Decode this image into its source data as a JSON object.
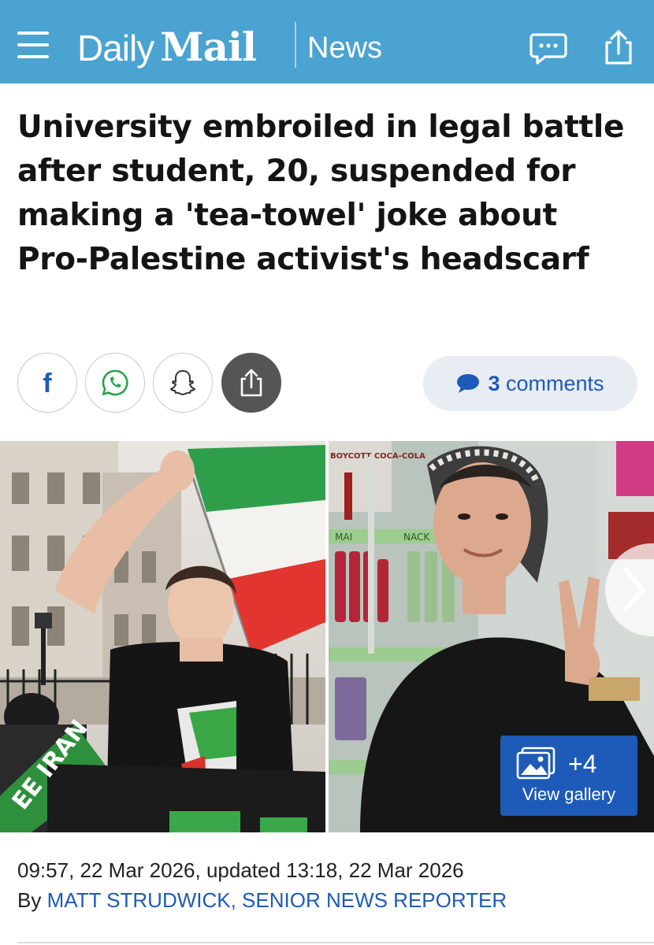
{
  "header": {
    "logo_daily": "Daily",
    "logo_mail": "Mail",
    "section": "News",
    "menu_icon": "hamburger-menu-icon",
    "chat_icon": "chat-bubble-icon",
    "share_icon": "share-upload-icon",
    "background_color": "#4aa3d1"
  },
  "article": {
    "headline": "University embroiled in legal battle after student, 20, suspended for making a 'tea-towel' joke about Pro-Palestine activist's headscarf",
    "timestamp": "09:57, 22 Mar 2026, updated 13:18, 22 Mar 2026",
    "byline_prefix": "By",
    "author": "MATT STRUDWICK, SENIOR NEWS REPORTER"
  },
  "share": {
    "buttons": [
      {
        "name": "facebook",
        "icon": "facebook-icon"
      },
      {
        "name": "whatsapp",
        "icon": "whatsapp-icon"
      },
      {
        "name": "snapchat",
        "icon": "snapchat-icon"
      },
      {
        "name": "share",
        "icon": "share-icon"
      }
    ],
    "comments_count": "3",
    "comments_label": "comments"
  },
  "gallery": {
    "count": "+4",
    "label": "View gallery",
    "sign_text": "EE IRAN",
    "shop_sign": "BOYCOTT COCA-COLA",
    "shop_label_1": "MAI",
    "shop_label_2": "NACK",
    "accent_color": "#1e5bb8"
  }
}
